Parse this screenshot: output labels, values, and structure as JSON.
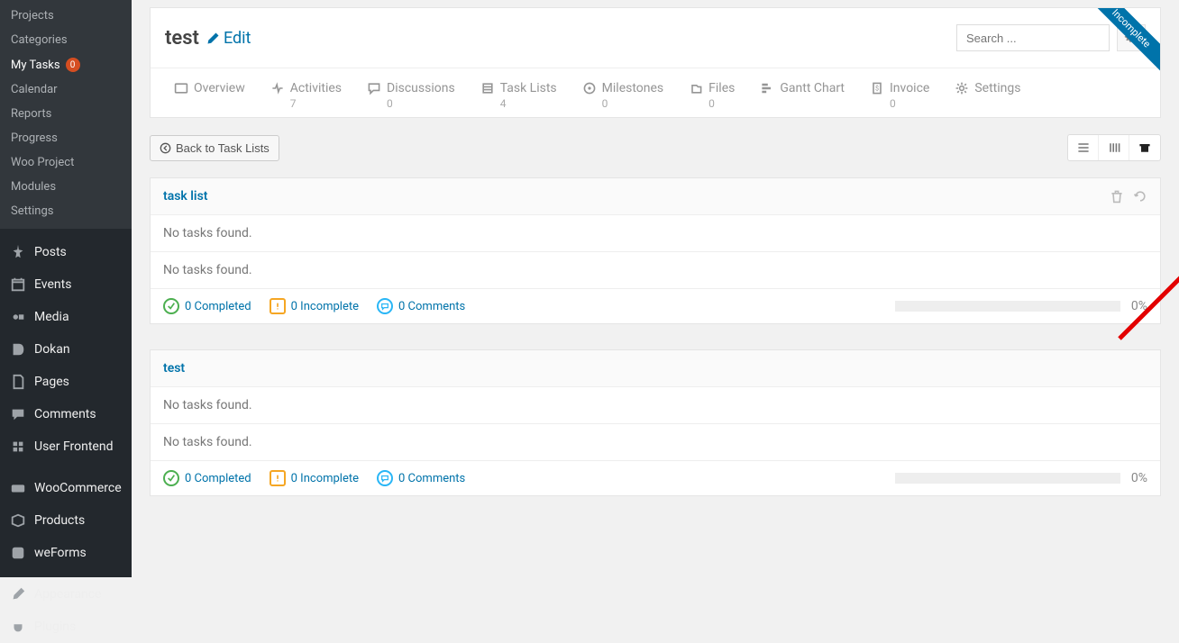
{
  "sidebar": {
    "sub": [
      {
        "label": "Projects"
      },
      {
        "label": "Categories"
      },
      {
        "label": "My Tasks",
        "badge": "0",
        "active": true
      },
      {
        "label": "Calendar"
      },
      {
        "label": "Reports"
      },
      {
        "label": "Progress"
      },
      {
        "label": "Woo Project"
      },
      {
        "label": "Modules"
      },
      {
        "label": "Settings"
      }
    ],
    "main": [
      {
        "label": "Posts",
        "icon": "pin"
      },
      {
        "label": "Events",
        "icon": "calendar"
      },
      {
        "label": "Media",
        "icon": "media"
      },
      {
        "label": "Dokan",
        "icon": "dokan"
      },
      {
        "label": "Pages",
        "icon": "pages"
      },
      {
        "label": "Comments",
        "icon": "chat"
      },
      {
        "label": "User Frontend",
        "icon": "uf"
      },
      {
        "label": "WooCommerce",
        "icon": "woo"
      },
      {
        "label": "Products",
        "icon": "box"
      },
      {
        "label": "weForms",
        "icon": "form"
      },
      {
        "label": "Appearance",
        "icon": "brush"
      },
      {
        "label": "Plugins",
        "icon": "plug"
      }
    ]
  },
  "project": {
    "title": "test",
    "edit_label": "Edit",
    "search_placeholder": "Search ...",
    "ribbon": "Incomplete"
  },
  "tabs": [
    {
      "label": "Overview",
      "count": ""
    },
    {
      "label": "Activities",
      "count": "7"
    },
    {
      "label": "Discussions",
      "count": "0"
    },
    {
      "label": "Task Lists",
      "count": "4"
    },
    {
      "label": "Milestones",
      "count": "0"
    },
    {
      "label": "Files",
      "count": "0"
    },
    {
      "label": "Gantt Chart",
      "count": ""
    },
    {
      "label": "Invoice",
      "count": "0"
    },
    {
      "label": "Settings",
      "count": ""
    }
  ],
  "toolbar": {
    "back_label": "Back to Task Lists"
  },
  "tasklists": [
    {
      "title": "task list",
      "empty1": "No tasks found.",
      "empty2": "No tasks found.",
      "completed_label": "0 Completed",
      "incomplete_label": "0 Incomplete",
      "comments_label": "0 Comments",
      "progress_pct": "0%",
      "show_actions": true
    },
    {
      "title": "test",
      "empty1": "No tasks found.",
      "empty2": "No tasks found.",
      "completed_label": "0 Completed",
      "incomplete_label": "0 Incomplete",
      "comments_label": "0 Comments",
      "progress_pct": "0%",
      "show_actions": false
    }
  ]
}
